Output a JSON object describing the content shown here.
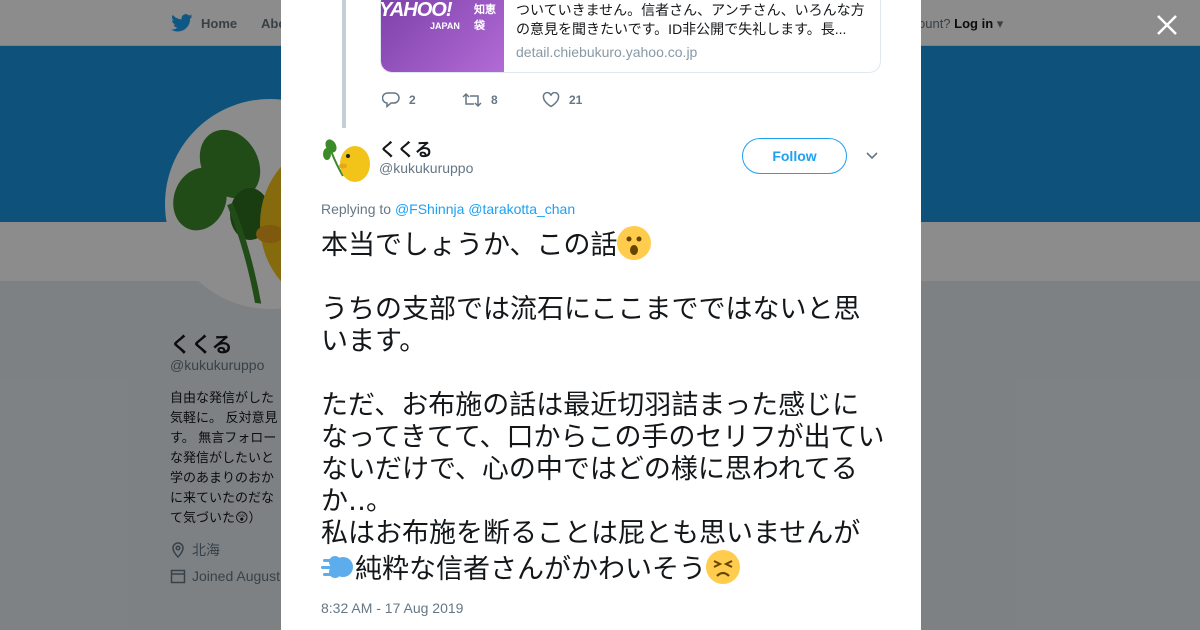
{
  "nav": {
    "home_label": "Home",
    "about_label": "Abo",
    "account_text": "ccount?",
    "login_label": "Log in"
  },
  "profile": {
    "name": "くくる",
    "handle": "@kukukuruppo",
    "bio": "自由な発信がした気軽に。 反対意見す。 無言フォローな発信がしたいと学のあまりのおかに来ていたのだなて気づいた😲）",
    "location": "北海",
    "joined": "Joined August"
  },
  "quoted_card": {
    "brand": "YAHOO!",
    "brand_sub": "JAPAN",
    "brand_tag": "知恵袋",
    "description": "ついていきません。信者さん、アンチさん、いろんな方の意見を聞きたいです。ID非公開で失礼します。長...",
    "domain": "detail.chiebukuro.yahoo.co.jp"
  },
  "prev_actions": {
    "replies": "2",
    "retweets": "8",
    "likes": "21"
  },
  "tweet": {
    "author_name": "くくる",
    "author_handle": "@kukukuruppo",
    "follow_label": "Follow",
    "replying_prefix": "Replying to",
    "reply_to_1": "@FShinnja",
    "reply_to_2": "@tarakotta_chan",
    "line_1": "本当でしょうか、この話",
    "para_2": "うちの支部では流石にここまでではないと思います。",
    "para_3": "ただ、お布施の話は最近切羽詰まった感じになってきてて、口からこの手のセリフが出ていないだけで、心の中ではどの様に思われてるか‥。\n私はお布施を断ることは屁とも思いませんが",
    "para_4": "純粋な信者さんがかわいそう",
    "timestamp": "8:32 AM - 17 Aug 2019"
  },
  "colors": {
    "twitter_blue": "#1da1f2",
    "banner": "#1b95e0",
    "text": "#14171a",
    "muted": "#657786"
  }
}
